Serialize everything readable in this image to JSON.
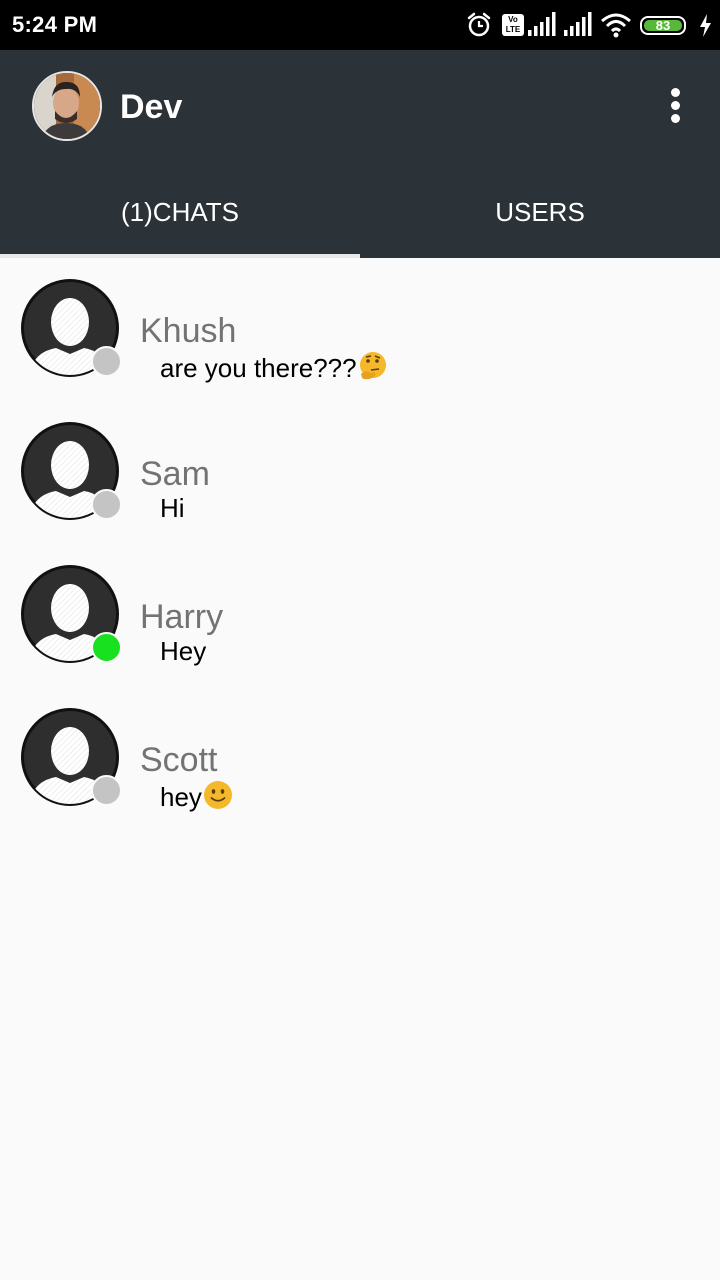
{
  "status_bar": {
    "time": "5:24 PM",
    "battery": "83",
    "volte_top": "Vo",
    "volte_bottom": "LTE"
  },
  "header": {
    "title": "Dev",
    "avatar_icon": "profile-photo",
    "menu_icon": "more-vertical-icon"
  },
  "tabs": [
    {
      "label": "(1)CHATS",
      "selected": true
    },
    {
      "label": "USERS",
      "selected": false
    }
  ],
  "colors": {
    "app_bar": "#2c3338",
    "online": "#18e11f",
    "offline": "#c4c4c4",
    "name_text": "#737373"
  },
  "chats": [
    {
      "name": "Khush",
      "message": "are you there???",
      "emoji": "thinking-face",
      "online": false
    },
    {
      "name": "Sam",
      "message": "Hi",
      "emoji": "",
      "online": false
    },
    {
      "name": "Harry",
      "message": "Hey",
      "emoji": "",
      "online": true
    },
    {
      "name": "Scott",
      "message": "hey",
      "emoji": "slightly-smiling-face",
      "online": false
    }
  ]
}
